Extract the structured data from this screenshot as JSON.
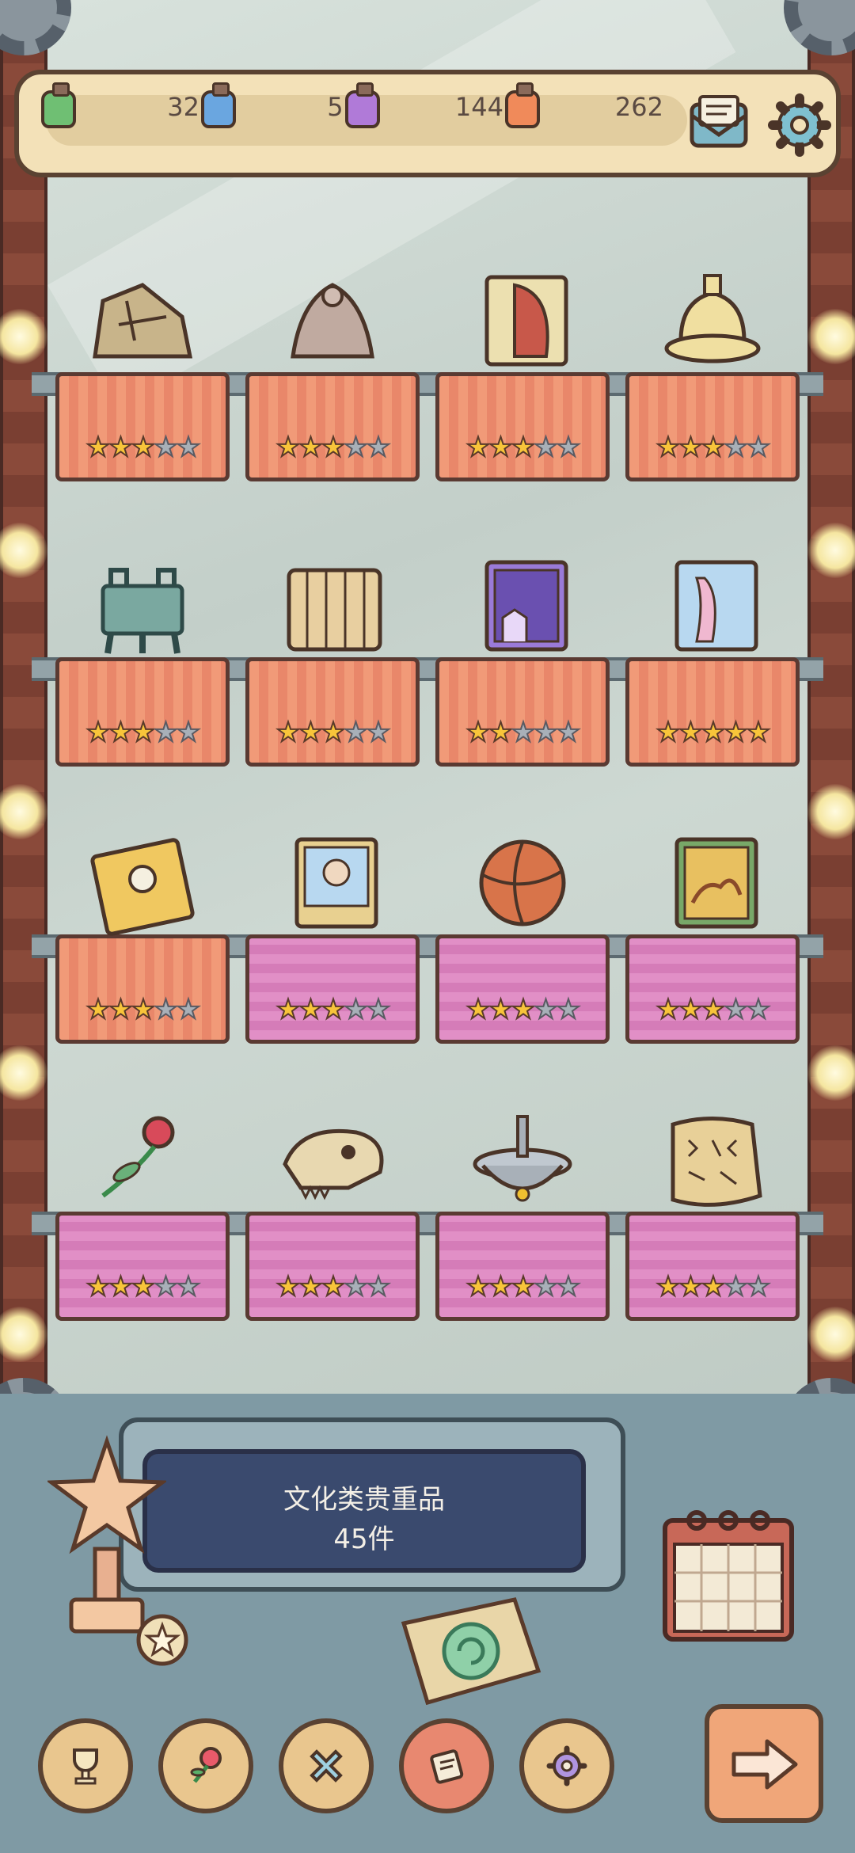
{
  "resources": [
    {
      "icon": "green-jar-icon",
      "value": "32",
      "color": "#6fbf73"
    },
    {
      "icon": "blue-jar-icon",
      "value": "51",
      "color": "#6aa6e0"
    },
    {
      "icon": "purple-jar-icon",
      "value": "144",
      "color": "#b07ad8"
    },
    {
      "icon": "orange-jar-icon",
      "value": "262",
      "color": "#f08a5a"
    }
  ],
  "header": {
    "mail_icon": "mail-icon",
    "settings_icon": "gear-icon"
  },
  "shelves": [
    {
      "cloth": "orange",
      "items": [
        {
          "icon": "stone-tablet-icon",
          "stars": 3,
          "max": 5
        },
        {
          "icon": "pieta-statue-icon",
          "stars": 3,
          "max": 5
        },
        {
          "icon": "book-rose-icon",
          "stars": 3,
          "max": 5
        },
        {
          "icon": "bell-icon",
          "stars": 3,
          "max": 5
        }
      ]
    },
    {
      "cloth": "orange",
      "items": [
        {
          "icon": "bronze-ding-icon",
          "stars": 3,
          "max": 5
        },
        {
          "icon": "bamboo-slips-icon",
          "stars": 3,
          "max": 5
        },
        {
          "icon": "book-night-icon",
          "stars": 2,
          "max": 5
        },
        {
          "icon": "book-lady-icon",
          "stars": 5,
          "max": 5
        }
      ]
    },
    {
      "cloth": "orange-pink",
      "items": [
        {
          "icon": "book-astronaut-icon",
          "stars": 3,
          "max": 5
        },
        {
          "icon": "portrait-book-icon",
          "stars": 3,
          "max": 5
        },
        {
          "icon": "basketball-icon",
          "stars": 3,
          "max": 5
        },
        {
          "icon": "book-horses-icon",
          "stars": 3,
          "max": 5
        }
      ]
    },
    {
      "cloth": "pink",
      "items": [
        {
          "icon": "rose-icon",
          "stars": 3,
          "max": 5
        },
        {
          "icon": "dinosaur-skull-icon",
          "stars": 3,
          "max": 5
        },
        {
          "icon": "spinning-top-icon",
          "stars": 3,
          "max": 5
        },
        {
          "icon": "rune-tablet-icon",
          "stars": 3,
          "max": 5
        }
      ]
    }
  ],
  "plaque": {
    "title": "文化类贵重品",
    "count": "45件"
  },
  "bottom_nav": [
    {
      "icon": "trophy-icon",
      "active": false
    },
    {
      "icon": "rose-icon",
      "active": false
    },
    {
      "icon": "cross-icon",
      "active": false
    },
    {
      "icon": "scroll-icon",
      "active": true
    },
    {
      "icon": "gear-icon",
      "active": false
    }
  ],
  "next_button": {
    "icon": "arrow-right-icon"
  }
}
